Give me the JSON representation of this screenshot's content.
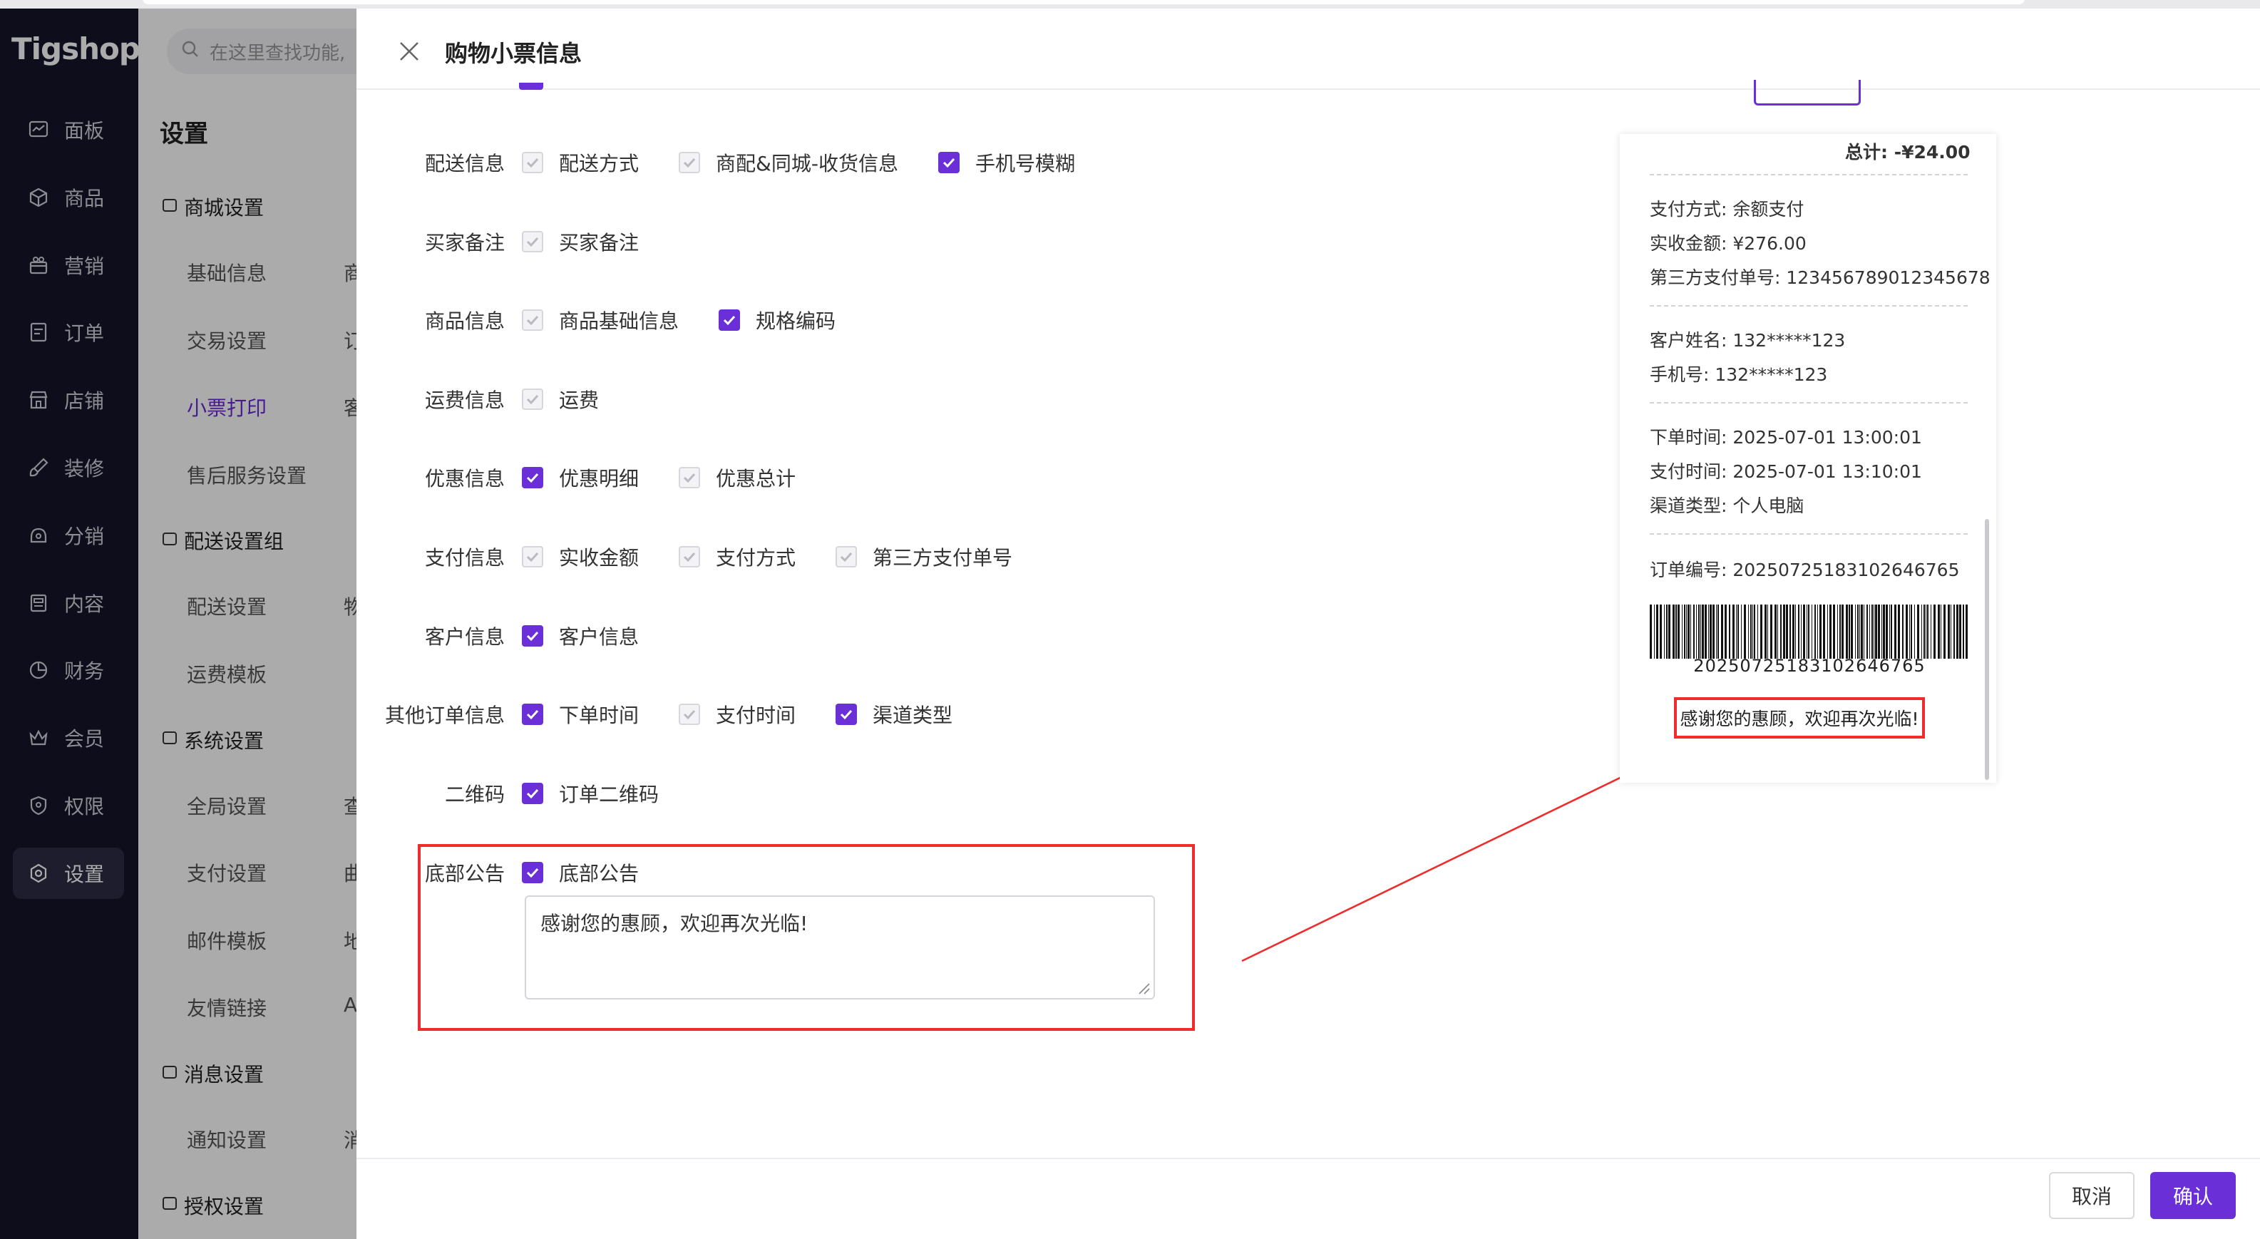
{
  "brand": {
    "logo": "Tigshop",
    "accent": "#6a2fd6",
    "highlight": "#ef2c2c"
  },
  "nav": {
    "items": [
      {
        "label": "面板",
        "icon": "dashboard-icon"
      },
      {
        "label": "商品",
        "icon": "box-icon"
      },
      {
        "label": "营销",
        "icon": "gift-icon"
      },
      {
        "label": "订单",
        "icon": "order-icon"
      },
      {
        "label": "店铺",
        "icon": "store-icon"
      },
      {
        "label": "装修",
        "icon": "brush-icon"
      },
      {
        "label": "分销",
        "icon": "share-icon"
      },
      {
        "label": "内容",
        "icon": "document-icon"
      },
      {
        "label": "财务",
        "icon": "pie-chart-icon"
      },
      {
        "label": "会员",
        "icon": "crown-icon"
      },
      {
        "label": "权限",
        "icon": "shield-icon"
      },
      {
        "label": "设置",
        "icon": "gear-icon"
      }
    ],
    "active": "设置"
  },
  "subnav": {
    "search_placeholder": "在这里查找功能,",
    "title": "设置",
    "groups": [
      {
        "title": "商城设置",
        "items": [
          {
            "label": "基础信息",
            "col2": "商"
          },
          {
            "label": "交易设置",
            "col2": "订"
          },
          {
            "label": "小票打印",
            "col2": "客"
          },
          {
            "label": "售后服务设置",
            "col2": ""
          }
        ]
      },
      {
        "title": "配送设置组",
        "items": [
          {
            "label": "配送设置",
            "col2": "物"
          },
          {
            "label": "运费模板",
            "col2": ""
          }
        ]
      },
      {
        "title": "系统设置",
        "items": [
          {
            "label": "全局设置",
            "col2": "查"
          },
          {
            "label": "支付设置",
            "col2": "曲"
          },
          {
            "label": "邮件模板",
            "col2": "地"
          },
          {
            "label": "友情链接",
            "col2": "A"
          }
        ]
      },
      {
        "title": "消息设置",
        "items": [
          {
            "label": "通知设置",
            "col2": "消"
          }
        ]
      },
      {
        "title": "授权设置",
        "items": []
      }
    ]
  },
  "drawer": {
    "title": "购物小票信息",
    "rows": [
      {
        "label": "配送信息",
        "options": [
          {
            "label": "配送方式",
            "state": "disabled"
          },
          {
            "label": "商配&同城-收货信息",
            "state": "disabled"
          },
          {
            "label": "手机号模糊",
            "state": "on"
          }
        ]
      },
      {
        "label": "买家备注",
        "options": [
          {
            "label": "买家备注",
            "state": "disabled"
          }
        ]
      },
      {
        "label": "商品信息",
        "options": [
          {
            "label": "商品基础信息",
            "state": "disabled"
          },
          {
            "label": "规格编码",
            "state": "on"
          }
        ]
      },
      {
        "label": "运费信息",
        "options": [
          {
            "label": "运费",
            "state": "disabled"
          }
        ]
      },
      {
        "label": "优惠信息",
        "options": [
          {
            "label": "优惠明细",
            "state": "on"
          },
          {
            "label": "优惠总计",
            "state": "disabled"
          }
        ]
      },
      {
        "label": "支付信息",
        "options": [
          {
            "label": "实收金额",
            "state": "disabled"
          },
          {
            "label": "支付方式",
            "state": "disabled"
          },
          {
            "label": "第三方支付单号",
            "state": "disabled"
          }
        ]
      },
      {
        "label": "客户信息",
        "options": [
          {
            "label": "客户信息",
            "state": "on"
          }
        ]
      },
      {
        "label": "其他订单信息",
        "options": [
          {
            "label": "下单时间",
            "state": "on"
          },
          {
            "label": "支付时间",
            "state": "disabled"
          },
          {
            "label": "渠道类型",
            "state": "on"
          }
        ]
      },
      {
        "label": "二维码",
        "options": [
          {
            "label": "订单二维码",
            "state": "on"
          }
        ]
      }
    ],
    "footer_notice": {
      "label": "底部公告",
      "checkbox_label": "底部公告",
      "checked": true,
      "text": "感谢您的惠顾，欢迎再次光临!"
    },
    "cancel_label": "取消",
    "confirm_label": "确认"
  },
  "receipt": {
    "total": "总计: -¥24.00",
    "payment_method": "支付方式: 余额支付",
    "amount_received": "实收金额: ¥276.00",
    "third_party_no": "第三方支付单号: 123456789012345678",
    "customer_name": "客户姓名: 132*****123",
    "phone": "手机号: 132*****123",
    "order_time": "下单时间: 2025-07-01 13:00:01",
    "pay_time": "支付时间: 2025-07-01 13:10:01",
    "channel": "渠道类型: 个人电脑",
    "order_no": "订单编号: 20250725183102646765",
    "barcode_number": "20250725183102646765",
    "thanks": "感谢您的惠顾，欢迎再次光临!"
  }
}
